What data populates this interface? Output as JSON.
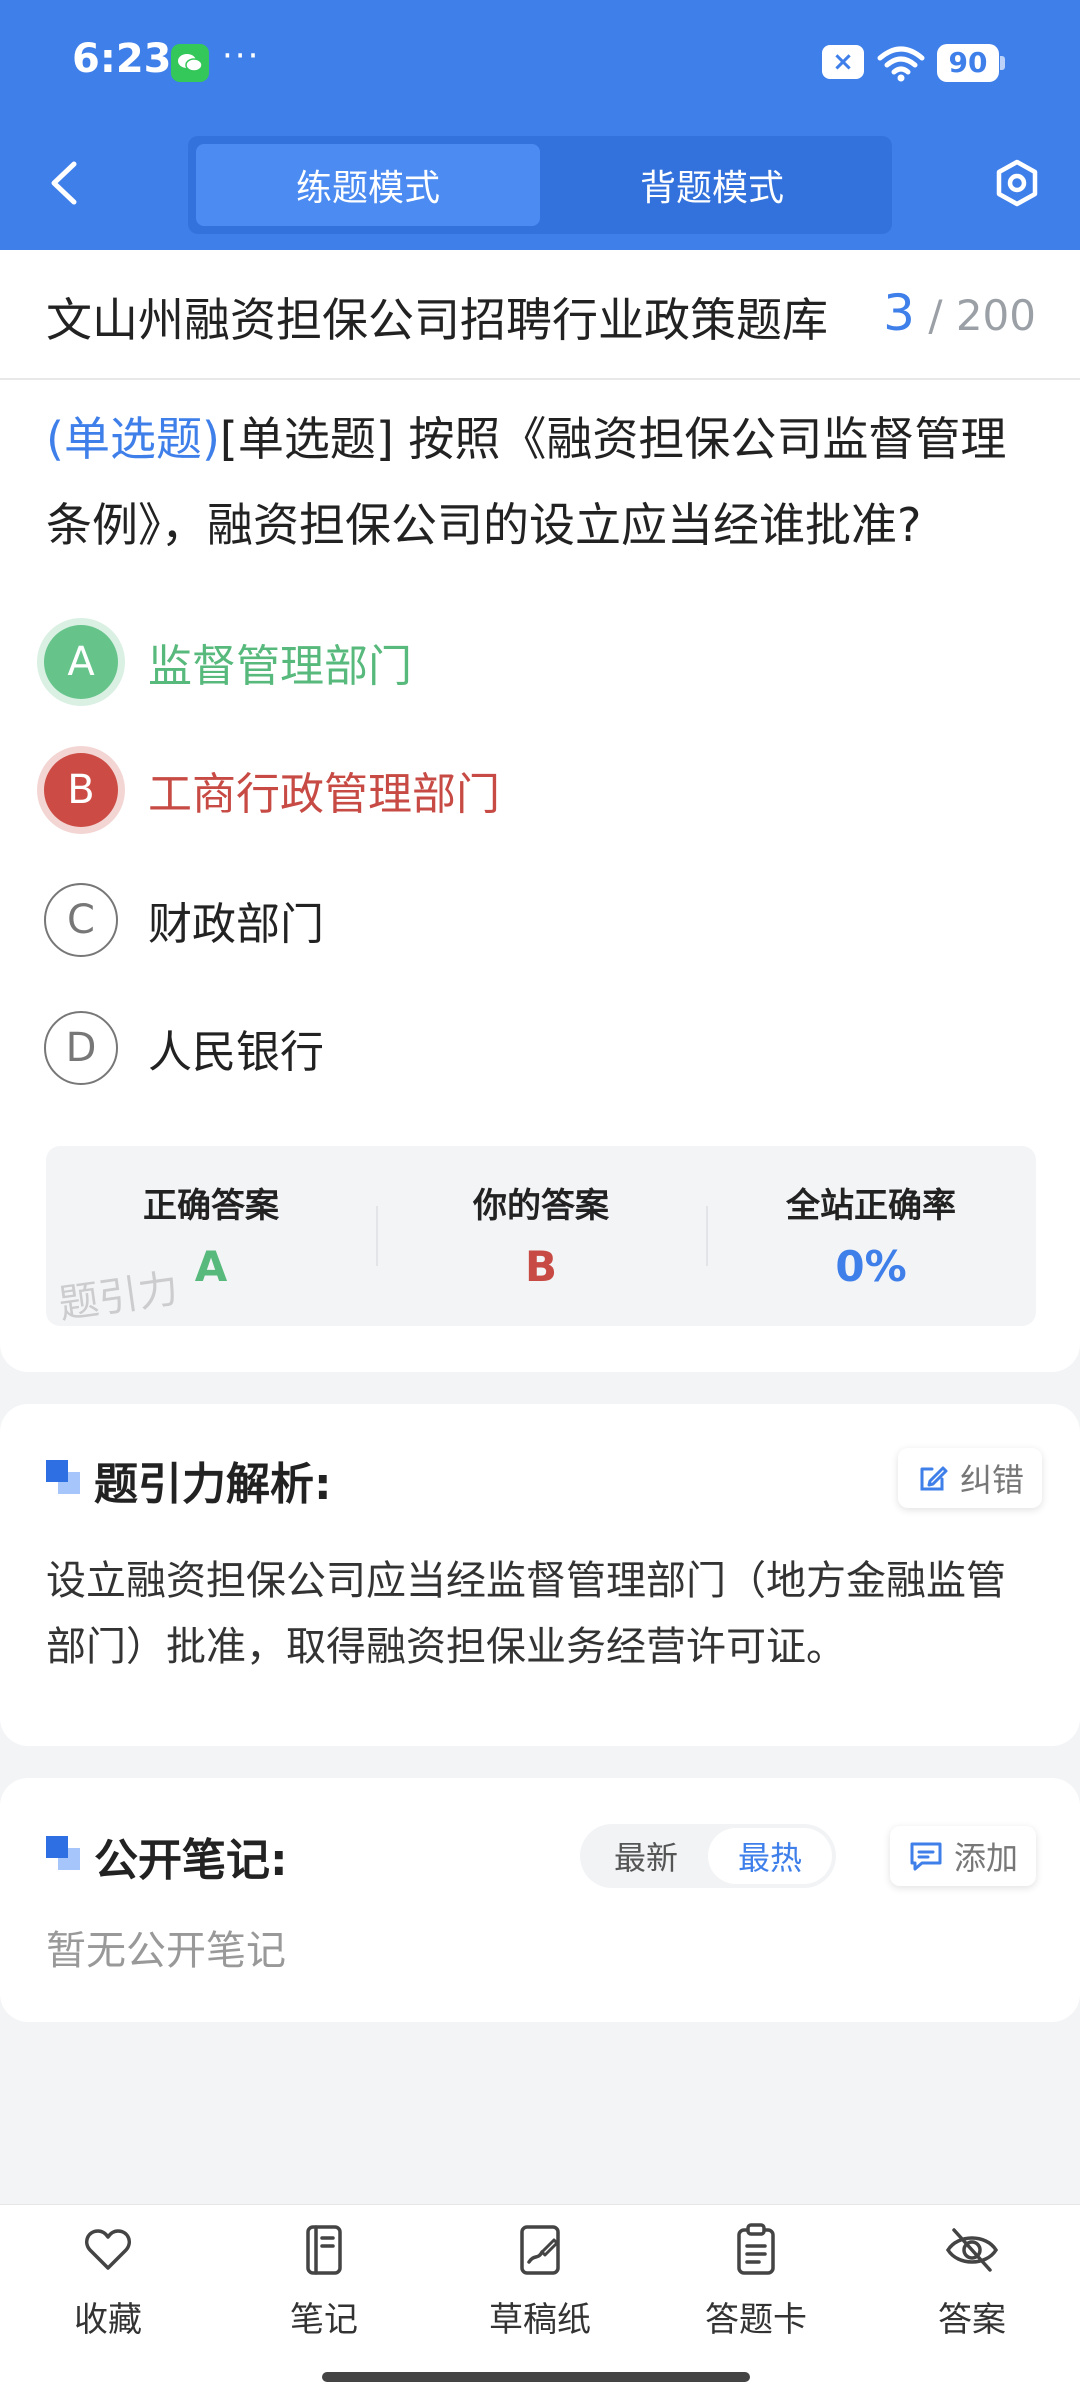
{
  "status_bar": {
    "time": "6:23",
    "dots": "···",
    "battery": "90"
  },
  "header": {
    "tabs": [
      {
        "label": "练题模式",
        "active": true
      },
      {
        "label": "背题模式",
        "active": false
      }
    ]
  },
  "bank": {
    "title": "文山州融资担保公司招聘行业政策题库",
    "current": "3",
    "total": "/ 200"
  },
  "question": {
    "type_tag": "(单选题)",
    "text": "[单选题] 按照《融资担保公司监督管理条例》，融资担保公司的设立应当经谁批准?"
  },
  "options": [
    {
      "letter": "A",
      "text": "监督管理部门",
      "state": "correct"
    },
    {
      "letter": "B",
      "text": "工商行政管理部门",
      "state": "wrong"
    },
    {
      "letter": "C",
      "text": "财政部门",
      "state": "plain"
    },
    {
      "letter": "D",
      "text": "人民银行",
      "state": "plain"
    }
  ],
  "answer_summary": {
    "correct_label": "正确答案",
    "correct_value": "A",
    "yours_label": "你的答案",
    "yours_value": "B",
    "rate_label": "全站正确率",
    "rate_value": "0%",
    "watermark": "题引力"
  },
  "analysis": {
    "title": "题引力解析:",
    "report_button": "纠错",
    "text": "设立融资担保公司应当经监督管理部门（地方金融监管部门）批准，取得融资担保业务经营许可证。"
  },
  "notes": {
    "title": "公开笔记:",
    "sort_options": [
      "最新",
      "最热"
    ],
    "add_button": "添加",
    "empty_text": "暂无公开笔记"
  },
  "bottom_nav": [
    {
      "label": "收藏",
      "icon": "heart-icon"
    },
    {
      "label": "笔记",
      "icon": "notebook-icon"
    },
    {
      "label": "草稿纸",
      "icon": "draft-icon"
    },
    {
      "label": "答题卡",
      "icon": "answer-card-icon"
    },
    {
      "label": "答案",
      "icon": "eye-off-icon"
    }
  ],
  "colors": {
    "primary": "#3f7fea",
    "correct": "#58b97c",
    "wrong": "#c74b44"
  }
}
